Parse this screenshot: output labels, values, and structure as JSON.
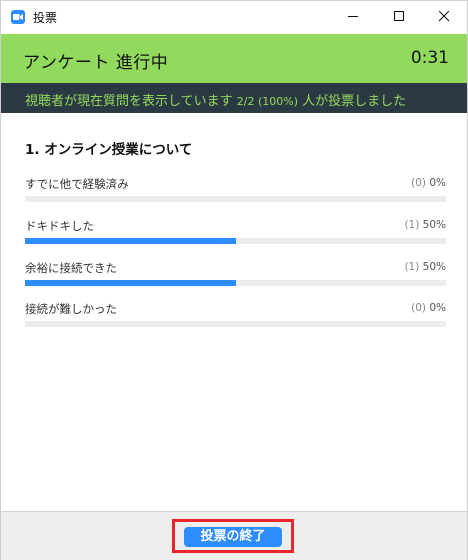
{
  "window": {
    "title": "投票"
  },
  "header": {
    "title": "アンケート 進行中",
    "timer": "0:31"
  },
  "status": {
    "prefix": "視聴者が現在質問を表示しています",
    "count": "2/2 (100%)",
    "suffix": "人が投票しました"
  },
  "poll": {
    "question": "1. オンライン授業について",
    "options": [
      {
        "label": "すでに他で経験済み",
        "count": "(0)",
        "percent": "0%",
        "share": 0
      },
      {
        "label": "ドキドキした",
        "count": "(1)",
        "percent": "50%",
        "share": 0.5
      },
      {
        "label": "余裕に接続できた",
        "count": "(1)",
        "percent": "50%",
        "share": 0.5
      },
      {
        "label": "接続が難しかった",
        "count": "(0)",
        "percent": "0%",
        "share": 0
      }
    ]
  },
  "footer": {
    "end_button": "投票の終了"
  },
  "colors": {
    "header": "#92da5d",
    "status_bg": "#2b3a42",
    "bar": "#2d8cff",
    "highlight": "#e8262b"
  }
}
